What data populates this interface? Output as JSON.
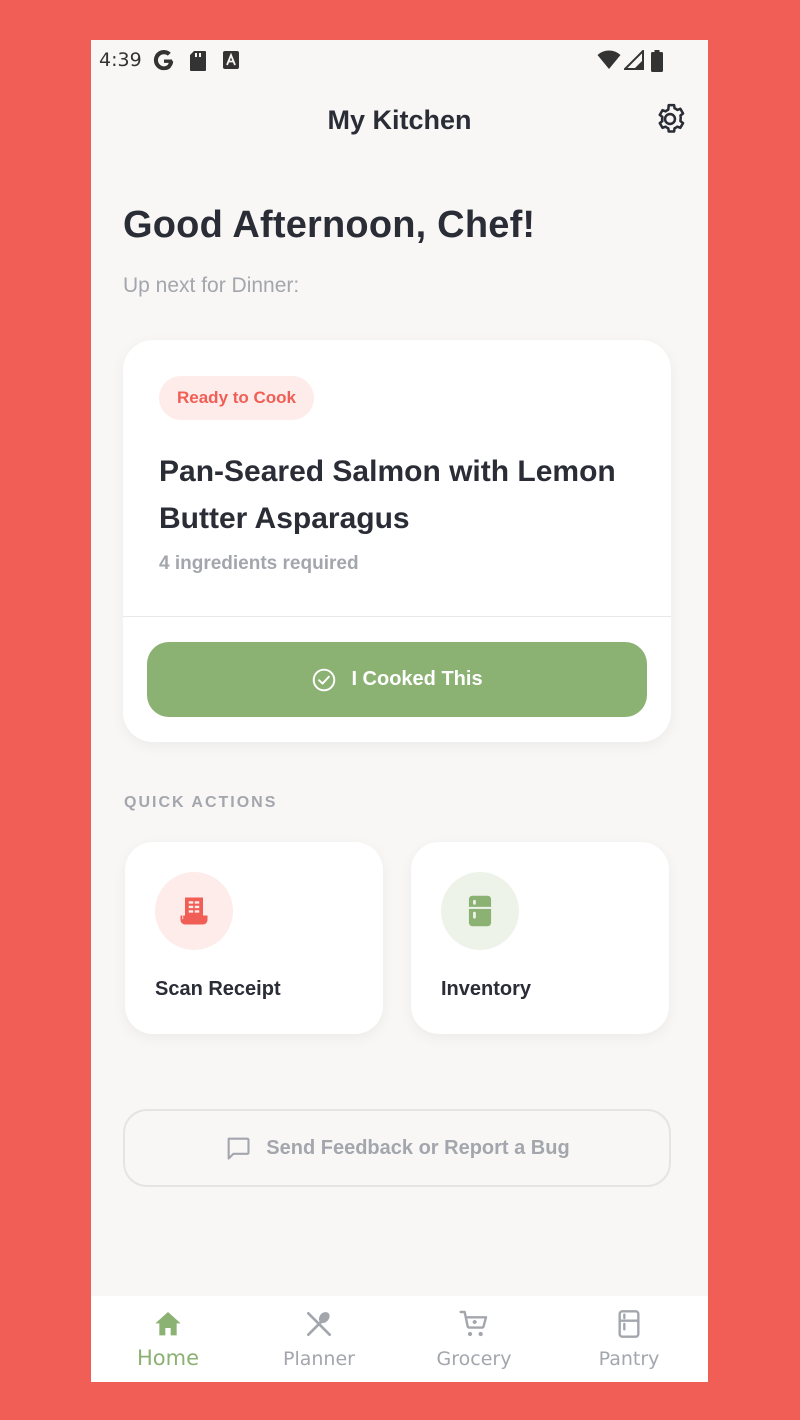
{
  "status_bar": {
    "time": "4:39",
    "left_icons": [
      "google-g-icon",
      "sd-card-icon",
      "keyboard-a-icon"
    ],
    "right_icons": [
      "wifi-icon",
      "cell-signal-icon",
      "battery-icon"
    ]
  },
  "app_bar": {
    "title": "My Kitchen",
    "settings_icon": "gear-icon"
  },
  "greeting": {
    "title": "Good Afternoon, Chef!",
    "subtitle": "Up next for Dinner:"
  },
  "meal_card": {
    "badge": "Ready to Cook",
    "recipe_title": "Pan-Seared Salmon with Lemon Butter Asparagus",
    "ingredients_text": "4 ingredients required",
    "button_label": "I Cooked This",
    "button_icon": "check-circle-icon"
  },
  "quick_actions": {
    "header": "QUICK ACTIONS",
    "items": [
      {
        "label": "Scan Receipt",
        "icon": "receipt-icon"
      },
      {
        "label": "Inventory",
        "icon": "fridge-icon"
      }
    ]
  },
  "feedback": {
    "label": "Send Feedback or Report a Bug",
    "icon": "chat-bubble-icon"
  },
  "bottom_nav": {
    "items": [
      {
        "label": "Home",
        "icon": "home-icon",
        "active": true
      },
      {
        "label": "Planner",
        "icon": "utensils-icon",
        "active": false
      },
      {
        "label": "Grocery",
        "icon": "cart-icon",
        "active": false
      },
      {
        "label": "Pantry",
        "icon": "fridge-icon",
        "active": false
      }
    ]
  },
  "colors": {
    "accent_red": "#F05E55",
    "accent_green": "#8BB173",
    "text_dark": "#2A2D36",
    "text_muted": "#A3A6AD",
    "background": "#F8F7F5"
  }
}
